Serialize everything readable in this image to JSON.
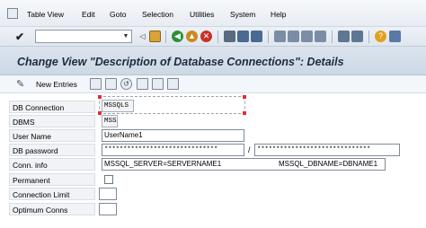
{
  "menu": {
    "items": [
      "Table View",
      "Edit",
      "Goto",
      "Selection",
      "Utilities",
      "System",
      "Help"
    ]
  },
  "toolbar": {
    "command_field_value": "",
    "icons": [
      "enter-icon",
      "back-icon",
      "save-icon",
      "exit-icon",
      "cancel-icon",
      "print-icon",
      "find-icon",
      "help-icon",
      "layout-icon"
    ]
  },
  "page": {
    "title": "Change View \"Description of Database Connections\": Details"
  },
  "app_toolbar": {
    "new_entries_label": "New Entries"
  },
  "form": {
    "db_connection": {
      "label": "DB Connection",
      "value": "MSSQLS"
    },
    "dbms": {
      "label": "DBMS",
      "value": "MSS"
    },
    "user_name": {
      "label": "User Name",
      "value": "UserName1"
    },
    "db_password": {
      "label": "DB password",
      "value1": "******************************",
      "separator": "/",
      "value2": "******************************"
    },
    "conn_info": {
      "label": "Conn. info",
      "value1": "MSSQL_SERVER=SERVERNAME1",
      "value2": "MSSQL_DBNAME=DBNAME1"
    },
    "permanent": {
      "label": "Permanent"
    },
    "connection_limit": {
      "label": "Connection Limit",
      "value": ""
    },
    "optimum_conns": {
      "label": "Optimum Conns",
      "value": ""
    }
  },
  "colors": {
    "selection_corner": "#e0302a",
    "title_text": "#1c2a3e"
  }
}
